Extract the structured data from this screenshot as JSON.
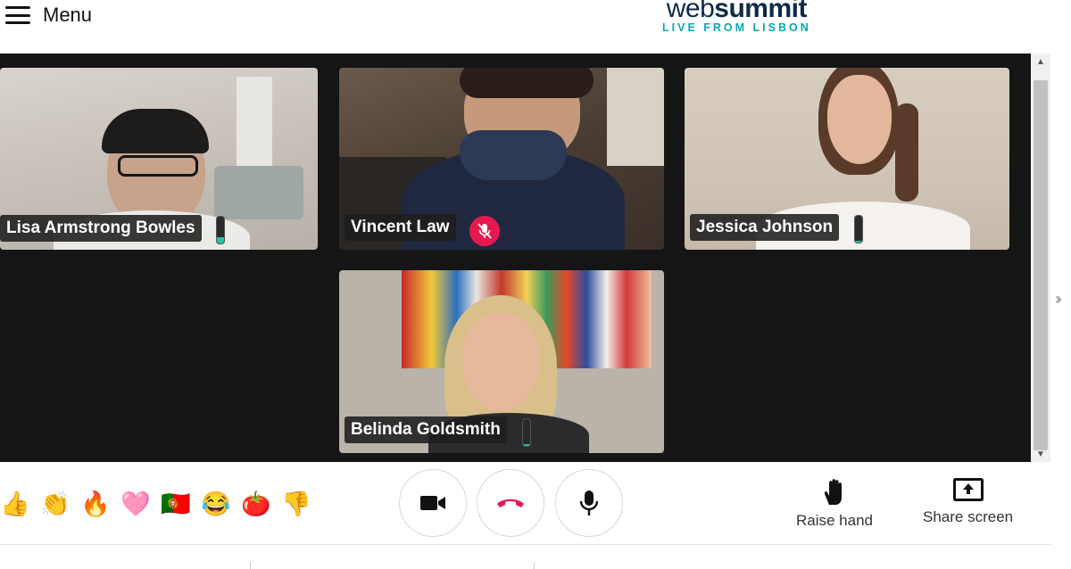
{
  "header": {
    "menu_label": "Menu",
    "logo_part1": "web",
    "logo_part2": "summit",
    "logo_sub": "LIVE FROM LISBON",
    "logo_sub_color": "#0aa8b0"
  },
  "participants": [
    {
      "name": "Lisa Armstrong Bowles",
      "muted": false,
      "mic_level": 0.25
    },
    {
      "name": "Vincent Law",
      "muted": true
    },
    {
      "name": "Jessica Johnson",
      "muted": false,
      "mic_level": 0.08
    },
    {
      "name": "Belinda Goldsmith",
      "muted": false,
      "mic_level": 0.08
    }
  ],
  "reactions": [
    {
      "icon": "thumbs-up-icon",
      "glyph": "👍"
    },
    {
      "icon": "clapping-hands-icon",
      "glyph": "👏"
    },
    {
      "icon": "fire-icon",
      "glyph": "🔥"
    },
    {
      "icon": "heart-icon",
      "glyph": "🩷"
    },
    {
      "icon": "portugal-flag-icon",
      "glyph": "🇵🇹"
    },
    {
      "icon": "laughing-face-icon",
      "glyph": "😂"
    },
    {
      "icon": "tomato-icon",
      "glyph": "🍅"
    },
    {
      "icon": "thumbs-down-icon",
      "glyph": "👎"
    }
  ],
  "controls": {
    "raise_hand_label": "Raise hand",
    "share_screen_label": "Share screen"
  },
  "colors": {
    "accent_teal": "#0aa8b0",
    "mute_red": "#e5194f",
    "hangup_red": "#e5194f",
    "mic_level_green": "#1fc7a4"
  }
}
